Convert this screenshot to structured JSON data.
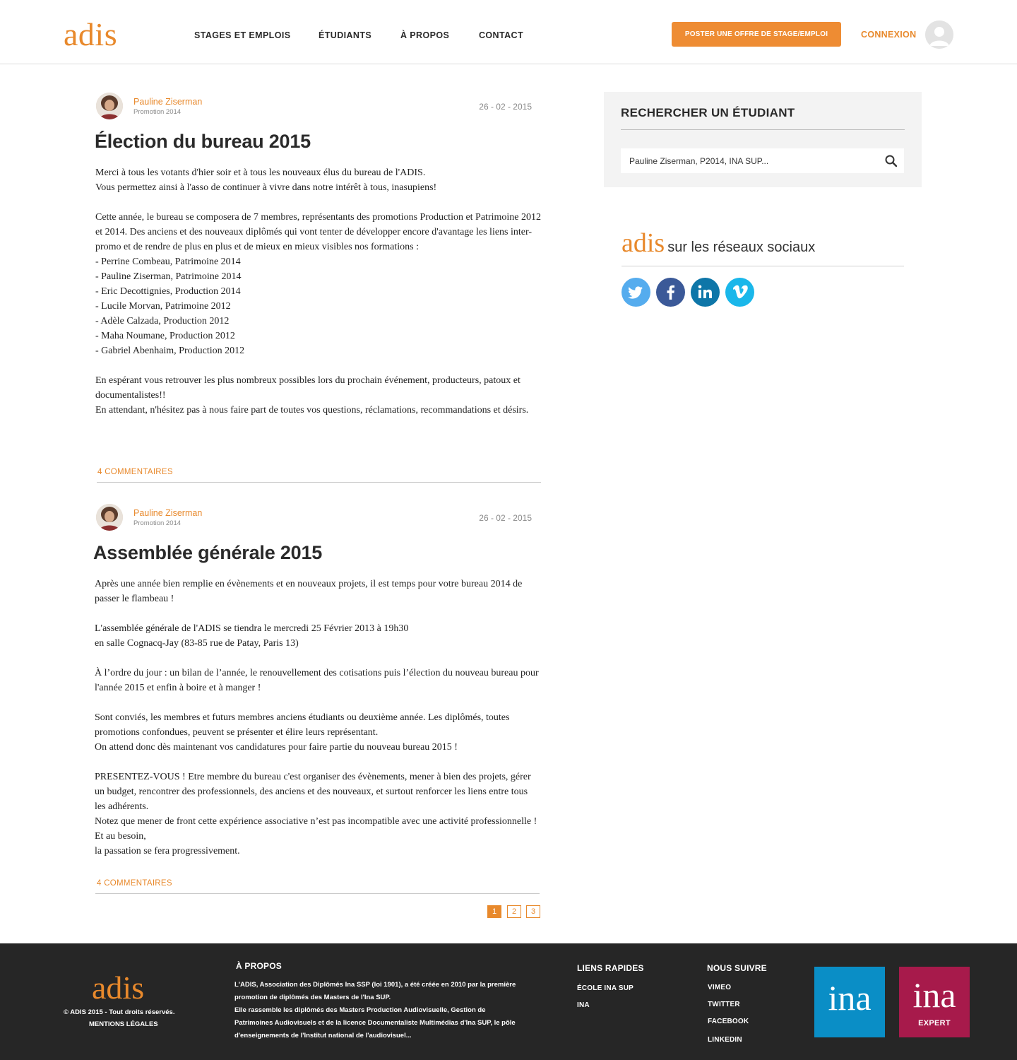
{
  "header": {
    "logo": "adis",
    "nav": [
      "STAGES ET EMPLOIS",
      "ÉTUDIANTS",
      "À PROPOS",
      "CONTACT"
    ],
    "post_button": "POSTER UNE OFFRE DE STAGE/EMPLOI",
    "login": "CONNEXION"
  },
  "posts": [
    {
      "author": "Pauline Ziserman",
      "promotion": "Promotion 2014",
      "date": "26 - 02 - 2015",
      "title": "Élection du bureau 2015",
      "body": "Merci à tous les votants d'hier soir et à tous les nouveaux élus du bureau de l'ADIS.\nVous permettez ainsi à l'asso de continuer à vivre dans notre intérêt à tous, inasupiens!\n\nCette année, le bureau se composera de 7 membres, représentants des promotions Production et Patrimoine 2012 et 2014. Des anciens et des nouveaux diplômés qui vont tenter de développer encore d'avantage les liens inter-promo et de rendre de plus en plus et de mieux en mieux visibles nos formations :\n- Perrine Combeau, Patrimoine 2014\n- Pauline Ziserman, Patrimoine 2014\n- Eric Decottignies, Production 2014\n- Lucile Morvan, Patrimoine 2012\n- Adèle Calzada, Production 2012\n- Maha Noumane, Production 2012\n- Gabriel Abenhaim, Production 2012\n\nEn espérant vous retrouver les plus nombreux possibles lors du prochain événement, producteurs, patoux et documentalistes!!\nEn attendant, n'hésitez pas à nous faire part de toutes vos questions, réclamations, recommandations et désirs.",
      "comments": "4 COMMENTAIRES"
    },
    {
      "author": "Pauline Ziserman",
      "promotion": "Promotion 2014",
      "date": "26 - 02 - 2015",
      "title": "Assemblée générale 2015",
      "body": "Après une année bien remplie en évènements et en nouveaux projets, il est temps pour votre bureau 2014 de passer le flambeau !\n\nL'assemblée générale de l'ADIS se tiendra le mercredi 25 Février 2013 à 19h30\nen salle Cognacq-Jay (83-85 rue de Patay, Paris 13)\n\nÀ l’ordre du jour : un bilan de l’année, le renouvellement des cotisations puis l’élection du nouveau bureau pour l'année 2015 et enfin à boire et à manger !\n\nSont conviés, les membres et futurs membres anciens étudiants ou deuxième année. Les diplômés, toutes promotions confondues, peuvent se présenter et élire leurs représentant.\nOn attend donc dès maintenant vos candidatures pour faire partie du nouveau bureau 2015 !\n\nPRESENTEZ-VOUS ! Etre membre du bureau c'est organiser des évènements, mener à bien des projets, gérer un budget, rencontrer des professionnels, des anciens et des nouveaux, et surtout renforcer les liens entre tous les adhérents.\nNotez que mener de front cette expérience associative n’est pas incompatible avec une activité professionnelle ! Et au besoin,\nla passation se fera progressivement.",
      "comments": "4 COMMENTAIRES"
    }
  ],
  "pagination": [
    "1",
    "2",
    "3"
  ],
  "sidebar": {
    "search_title": "RECHERCHER UN ÉTUDIANT",
    "search_placeholder": "Pauline Ziserman, P2014, INA SUP...",
    "social_logo": "adis",
    "social_text": "sur les réseaux sociaux",
    "social_icons": [
      "twitter-icon",
      "facebook-icon",
      "linkedin-icon",
      "vimeo-icon"
    ]
  },
  "footer": {
    "logo": "adis",
    "copyright": "© ADIS 2015 - Tout droits réservés.",
    "legal": "MENTIONS LÉGALES",
    "about_title": "À PROPOS",
    "about_text": "L'ADIS, Association des Diplômés Ina SSP (loi 1901), a été créée en 2010 par la première promotion de diplômés des Masters de l'Ina SUP.\nElle rassemble les diplômés des Masters Production Audiovisuelle, Gestion de Patrimoines Audiovisuels et de la licence Documentaliste Multimédias d'Ina SUP, le pôle d'enseignements de l'Institut national de l'audiovisuel...",
    "quick_links_title": "LIENS RAPIDES",
    "quick_links": [
      "ÉCOLE INA SUP",
      "INA"
    ],
    "follow_title": "NOUS SUIVRE",
    "follow_links": [
      "VIMEO",
      "TWITTER",
      "FACEBOOK",
      "LINKEDIN"
    ],
    "ina_logo": "ina",
    "ina_expert_logo": "ina",
    "ina_expert_sub": "EXPERT"
  },
  "colors": {
    "accent": "#e8892c",
    "footer_bg": "#262626",
    "twitter": "#55acee",
    "facebook": "#3b5998",
    "linkedin": "#0e76a8",
    "vimeo": "#1ab7ea",
    "ina_blue": "#0a8ec6",
    "ina_expert": "#a71a4b"
  }
}
